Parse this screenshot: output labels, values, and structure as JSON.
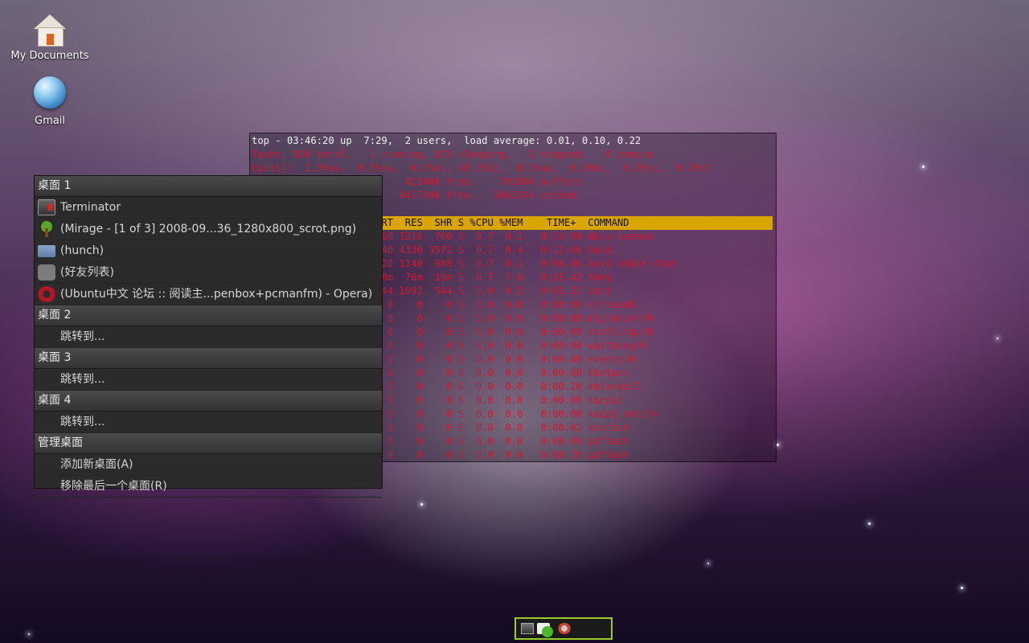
{
  "desktop_icons": [
    {
      "label": "My Documents",
      "icon": "home-folder-icon"
    },
    {
      "label": "Gmail",
      "icon": "globe-icon"
    }
  ],
  "terminal": {
    "line1": "top - 03:46:20 up  7:29,  2 users,  load average: 0.01, 0.10, 0.22",
    "line2": "Tasks: 106 total,   1 running, 105 sleeping,   0 stopped,   0 zombie",
    "line3": "Cpu(s):  1.3%us,  0.3%sy,  0.0%ni, 98.3%id,  0.0%wa,  0.0%hi,  0.0%si,  0.0%st",
    "line4": "     ,   991716k used,    42340k free,    70180k buffers",
    "line5": "     ,    38164k used,   941760k free,   506524k cached",
    "header": "                NI  VIRT  RES  SHR S %CPU %MEM    TIME+  COMMAND",
    "rows": [
      "                 0  2860 1316  760 S  0.7  0.1   0:16.90 dbus-daemon",
      "                 0  6340 4336 3572 S  0.7  0.4   0:12.66 hald",
      "                 0  3420 1140  988 S  0.7  0.1   0:06.86 hald-addon-stor",
      "                 0  178m  76m  19m S  0.7  7.6   0:31.42 Xorg",
      "                 0  2844 1692  544 S  0.0  0.2   0:01.22 init",
      "                 5     0    0    0 S  0.0  0.0   0:00.00 kthreadd",
      "                 5     0    0    0 S  0.0  0.0   0:00.00 migration/0",
      "                 5     0    0    0 S  0.0  0.0   0:00.08 ksoftirqd/0",
      "                 5     0    0    0 S  0.0  0.0   0:00.00 watchdog/0",
      "                 5     0    0    0 S  0.0  0.0   0:00.48 events/0",
      "                 5     0    0    0 S  0.0  0.0   0:00.00 khelper",
      "                 5     0    0    0 S  0.0  0.0   0:00.20 kblockd/0",
      "                 5     0    0    0 S  0.0  0.0   0:00.00 kacpid",
      "                 5     0    0    0 S  0.0  0.0   0:00.00 kacpi_notify",
      "                 5     0    0    0 S  0.0  0.0   0:00.02 kseriod",
      "                 0     0    0    0 S  0.0  0.0   0:00.00 pdflush",
      "                 0     0    0    0 S  0.0  0.0   0:00.78 pdflush"
    ]
  },
  "menu": {
    "desk1": "桌面 1",
    "desk1_items": [
      {
        "label": "Terminator",
        "icon": "terminal-icon"
      },
      {
        "label": "(Mirage - [1 of 3] 2008-09...36_1280x800_scrot.png)",
        "icon": "tree-icon"
      },
      {
        "label": "(hunch)",
        "icon": "folder-icon"
      },
      {
        "label": "(好友列表)",
        "icon": "chat-icon"
      },
      {
        "label": "(Ubuntu中文 论坛 :: 阅读主...penbox+pcmanfm) - Opera)",
        "icon": "opera-icon"
      }
    ],
    "desk2": "桌面 2",
    "desk2_goto": "跳转到...",
    "desk3": "桌面 3",
    "desk3_goto": "跳转到...",
    "desk4": "桌面 4",
    "desk4_goto": "跳转到...",
    "manage": "管理桌面",
    "add_desktop": "添加新桌面(A)",
    "remove_desktop": "移除最后一个桌面(R)"
  },
  "tray": [
    "terminal-tray-icon",
    "chat-tray-icon",
    "opera-tray-icon"
  ]
}
